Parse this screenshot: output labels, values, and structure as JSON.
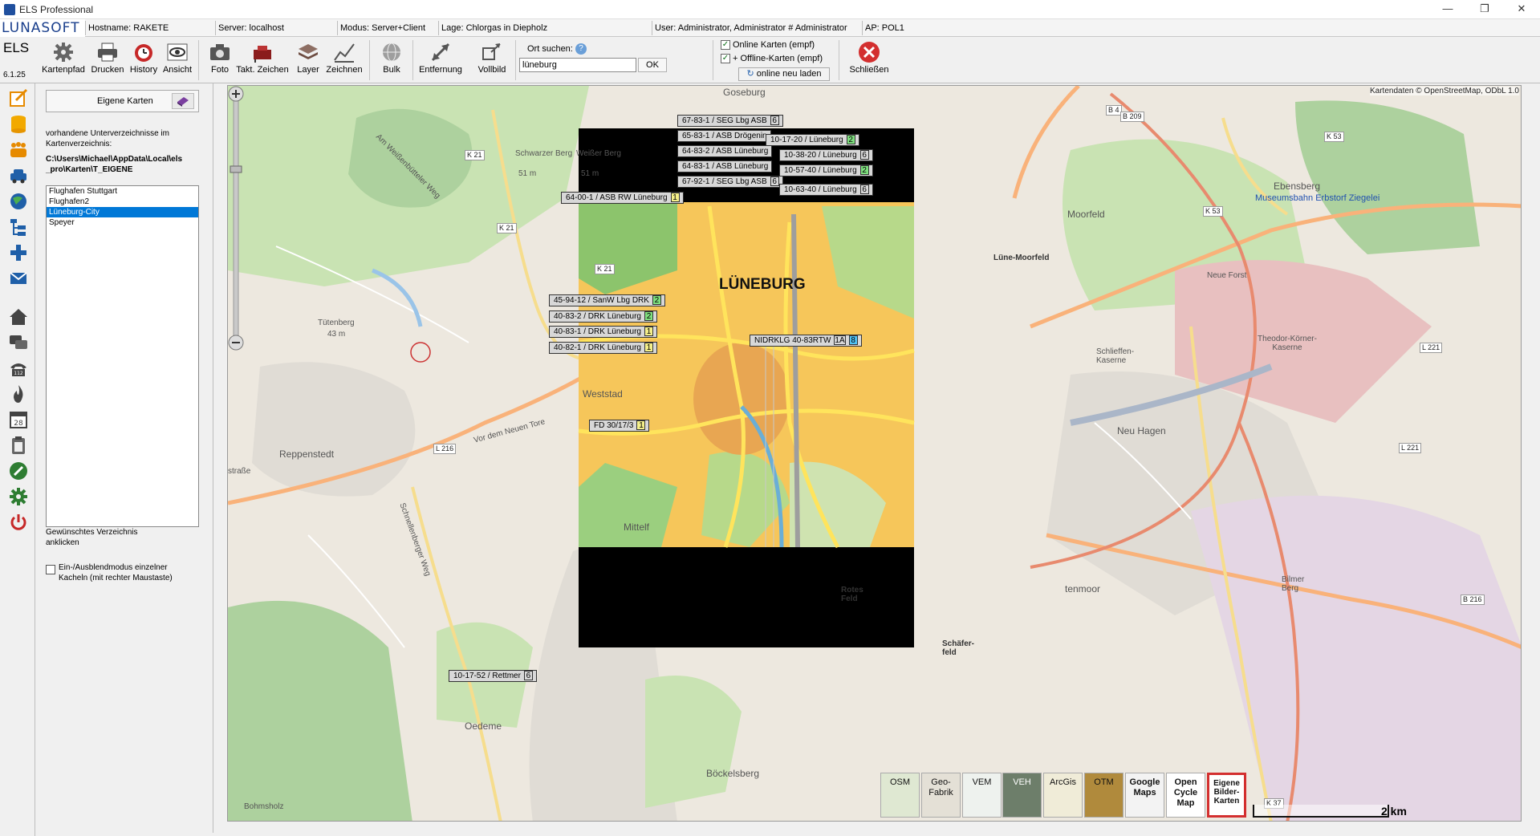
{
  "window": {
    "title": "ELS Professional",
    "controls": {
      "minimize": "—",
      "restore": "❐",
      "close": "✕"
    }
  },
  "infobar": {
    "logo": "LUNASOFT",
    "hostname": "Hostname: RAKETE",
    "server": "Server: localhost",
    "mode": "Modus: Server+Client",
    "situation": "Lage: Chlorgas in Diepholz",
    "user": "User: Administrator, Administrator # Administrator",
    "ap": "AP: POL1"
  },
  "toolbar": {
    "app": "ELS",
    "version": "6.1.25",
    "buttons": {
      "kartenpfad": "Kartenpfad",
      "drucken": "Drucken",
      "history": "History",
      "ansicht": "Ansicht",
      "foto": "Foto",
      "takt": "Takt. Zeichen",
      "layer": "Layer",
      "zeichnen": "Zeichnen",
      "bulk": "Bulk",
      "entfernung": "Entfernung",
      "vollbild": "Vollbild",
      "schliessen": "Schließen"
    },
    "search": {
      "label": "Ort suchen:",
      "help": "?",
      "value": "lüneburg",
      "ok": "OK"
    },
    "online_maps": {
      "label": "Online Karten (empf)",
      "checked": true
    },
    "offline_maps": {
      "label": "+ Offline-Karten (empf)",
      "checked": true
    },
    "reload": "online neu laden"
  },
  "panel": {
    "header": "Eigene Karten",
    "intro": "vorhandene Unterverzeichnisse im Kartenverzeichnis:",
    "path": "C:\\Users\\Michael\\AppData\\Local\\els_pro\\Karten\\T_EIGENE",
    "directories": [
      "Flughafen Stuttgart",
      "Flughafen2",
      "Lüneburg-City",
      "Speyer"
    ],
    "selected_index": 2,
    "hint": "Gewünschtes Verzeichnis anklicken",
    "toggle_label": "Ein-/Ausblendmodus einzelner Kacheln (mit rechter Maustaste)",
    "toggle_checked": false
  },
  "map": {
    "attribution": "Kartendaten © OpenStreetMap, ODbL 1.0",
    "places": {
      "goseburg": "Goseburg",
      "schwarzer_berg": "Schwarzer Berg",
      "schwarzer_berg_h": "51 m",
      "weisser_berg": "Weißer Berg",
      "weisser_berg_h": "51 m",
      "ebensberg": "Ebensberg",
      "museumsbahn": "Museumsbahn Erbstorf Ziegelei",
      "moorfeld": "Moorfeld",
      "neue_forst": "Neue Forst",
      "tuetenberg": "Tütenberg",
      "tuetenberg_h": "43 m",
      "theodor_koerner": "Theodor-Körner-Kaserne",
      "schlieffen": "Schlieffen-Kaserne",
      "reppenstedt": "Reppenstedt",
      "weststadt": "Weststad",
      "neu_hagen": "Neu Hagen",
      "mittelfeld": "Mittelf",
      "oedeme": "Oedeme",
      "boeckelsberg": "Böckelsberg",
      "bohmsholz": "Bohmsholz",
      "bilmer_berg": "Bilmer Berg",
      "lueneburg": "LÜNEBURG",
      "luene_moorfeld": "Lüne-Moorfeld",
      "rotes_feld": "Rotes Feld",
      "schaeferfeld": "Schäfer-feld",
      "tenmoor": "tenmoor",
      "strasse": "straße",
      "vor_dem_neuen_tore": "Vor dem Neuen Tore",
      "schnellenberger_weg": "Schnellenberger Weg",
      "am_weissen_weg": "Am Weißenbütteler Weg"
    },
    "units": [
      {
        "label": "67-83-1 / SEG Lbg ASB",
        "count": "6",
        "color": "#d8d8d8"
      },
      {
        "label": "65-83-1 / ASB Drögenin",
        "count": "",
        "color": "#d8d8d8"
      },
      {
        "label": "10-17-20 / Lüneburg",
        "count": "2",
        "color": "#7fe07f"
      },
      {
        "label": "64-83-2 / ASB Lüneburg",
        "count": "",
        "color": "#d8d8d8"
      },
      {
        "label": "10-38-20 / Lüneburg",
        "count": "6",
        "color": "#d8d8d8"
      },
      {
        "label": "64-83-1 / ASB Lüneburg",
        "count": "",
        "color": "#d8d8d8"
      },
      {
        "label": "10-57-40 / Lüneburg",
        "count": "2",
        "color": "#7fe07f"
      },
      {
        "label": "67-92-1 / SEG Lbg ASB",
        "count": "6",
        "color": "#d8d8d8"
      },
      {
        "label": "10-63-40 / Lüneburg",
        "count": "6",
        "color": "#d8d8d8"
      },
      {
        "label": "64-00-1 / ASB RW Lüneburg",
        "count": "1",
        "color": "#f5f08a"
      },
      {
        "label": "45-94-12 / SanW Lbg DRK",
        "count": "2",
        "color": "#7fe07f"
      },
      {
        "label": "40-83-2 / DRK Lüneburg",
        "count": "2",
        "color": "#7fe07f"
      },
      {
        "label": "40-83-1 / DRK Lüneburg",
        "count": "1",
        "color": "#f5f08a"
      },
      {
        "label": "40-82-1 / DRK Lüneburg",
        "count": "1",
        "color": "#f5f08a"
      },
      {
        "label": "NIDRKLG 40-83RTW",
        "count": "1A",
        "count2": "8",
        "color": "#d8d8d8"
      },
      {
        "label": "FD 30/17/3",
        "count": "1",
        "color": "#f5f08a"
      },
      {
        "label": "10-17-52 / Rettmer",
        "count": "6",
        "color": "#d8d8d8"
      }
    ],
    "roads": [
      "K 21",
      "K 21",
      "K 21",
      "L 216",
      "B 4",
      "B 209",
      "K 53",
      "K 53",
      "L 221",
      "L 221",
      "B 216",
      "K 37"
    ],
    "layer_buttons": [
      "OSM",
      "Geo-Fabrik",
      "VEM",
      "VEH",
      "ArcGis",
      "OTM",
      "Google Maps",
      "Open Cycle Map",
      "Eigene Bilder-Karten"
    ],
    "active_layer_index": 8,
    "scale": "2 km",
    "colors": {
      "selection": "#0078d7",
      "park": "#c9e3b3",
      "forest": "#add19e",
      "urban": "#e0dcd5",
      "orange_map": "#f6c65a"
    }
  }
}
